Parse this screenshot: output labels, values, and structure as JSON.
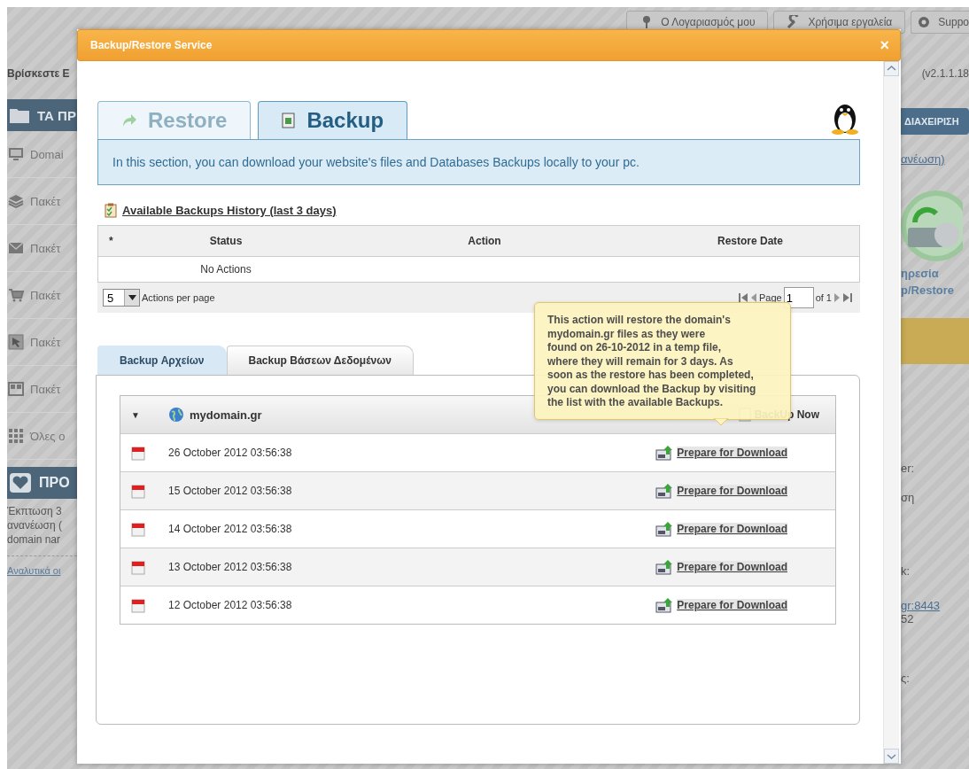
{
  "background_page": {
    "top_buttons": [
      {
        "label": "Ο Λογαριασμός μου"
      },
      {
        "label": "Χρήσιμα εργαλεία"
      },
      {
        "label": "Suppo"
      }
    ],
    "breadcrumb": "Βρίσκεστε Ε",
    "version": "(v2.1.1.18",
    "left_section_title": "ΤΑ ΠΡ",
    "left_menu": [
      {
        "label": "Domai"
      },
      {
        "label": "Πακέτ"
      },
      {
        "label": "Πακέτ"
      },
      {
        "label": "Πακέτ"
      },
      {
        "label": "Πακέτ"
      },
      {
        "label": "Πακέτ"
      },
      {
        "label": "Όλες ο"
      }
    ],
    "promo": {
      "title": "ΠΡΟ",
      "text": "Έκπτωση 3\nανανέωση (\ndomain nar",
      "link": "Αναλυτικά οι"
    },
    "right_button": "ΔΙΑΧΕΙΡΙΣΗ",
    "right_link": "ανέωση)",
    "service_label": "ηρεσία\np/Restore",
    "right_lines": [
      {
        "kind": "text",
        "text": "er:"
      },
      {
        "kind": "text",
        "text": "ση"
      },
      {
        "kind": "text",
        "text": "k:"
      },
      {
        "kind": "link",
        "text": "gr:8443"
      },
      {
        "kind": "text",
        "text": "52"
      },
      {
        "kind": "text",
        "text": "ς:"
      }
    ]
  },
  "dialog": {
    "title": "Backup/Restore Service",
    "close": "×",
    "tabs": [
      {
        "label": "Restore",
        "selected": false
      },
      {
        "label": "Backup",
        "selected": true
      }
    ],
    "info": "In this section, you can download your website's files and Databases Backups locally to your pc.",
    "history": {
      "title": "Available Backups History (last 3 days)",
      "columns": [
        "*",
        "Status",
        "Action",
        "Restore Date"
      ],
      "rows": [
        {
          "status": "No Actions"
        }
      ],
      "per_page": "5",
      "per_page_label": "Actions per page",
      "page_label": "Page",
      "page": "1",
      "page_of": "of 1"
    },
    "backup_tabs": [
      {
        "label": "Backup Αρχείων",
        "selected": true
      },
      {
        "label": "Backup Βάσεων Δεδομένων",
        "selected": false
      }
    ],
    "domain": {
      "caret": "▼",
      "name": "mydomain.gr",
      "backup_now": "BackUp Now"
    },
    "backups": [
      {
        "date": "26 October 2012 03:56:38",
        "action": "Prepare for Download"
      },
      {
        "date": "15 October 2012 03:56:38",
        "action": "Prepare for Download"
      },
      {
        "date": "14 October 2012 03:56:38",
        "action": "Prepare for Download"
      },
      {
        "date": "13 October 2012 03:56:38",
        "action": "Prepare for Download"
      },
      {
        "date": "12 October 2012 03:56:38",
        "action": "Prepare for Download"
      }
    ],
    "tooltip": "This action will restore the domain's\nmydomain.gr  files as they were\nfound on 26-10-2012 in a temp file,\nwhere they will remain for 3 days. As\nsoon as the restore has been completed,\nyou can download the Backup by visiting\nthe list with the available Backups."
  }
}
